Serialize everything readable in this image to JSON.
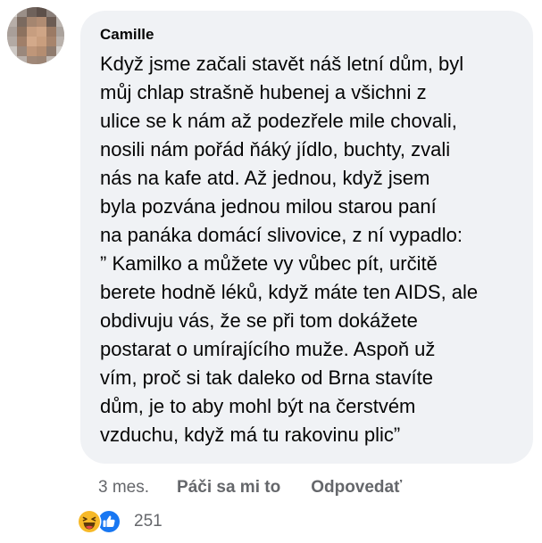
{
  "comment": {
    "author": "Camille",
    "text": "Když jsme začali stavět náš letní dům, byl\nmůj chlap strašně hubenej a všichni z\nulice se k nám až podezřele mile chovali,\nnosili nám pořád ňáký jídlo, buchty, zvali\nnás na kafe atd. Až jednou, když jsem\nbyla pozvána jednou milou starou paní\nna panáka domácí slivovice, z ní vypadlo:\n” Kamilko a můžete vy vůbec pít, určitě\nberete hodně léků, když máte ten AIDS, ale\nobdivuju vás, že se při tom dokážete\npostarat o umírajícího muže. Aspoň už\nvím, proč si tak daleko od Brna stavíte\ndům, je to aby mohl být na čerstvém\nvzduchu, když má tu rakovinu plic”"
  },
  "actions": {
    "time": "3 mes.",
    "like_label": "Páči sa mi to",
    "reply_label": "Odpovedať"
  },
  "reactions": {
    "count": "251",
    "icons": [
      "haha-icon",
      "like-icon"
    ]
  },
  "colors": {
    "bubble_bg": "#f0f2f5",
    "text": "#050505",
    "secondary_text": "#65676b",
    "like_blue": "#1877f2",
    "haha_yellow": "#f7b928"
  }
}
